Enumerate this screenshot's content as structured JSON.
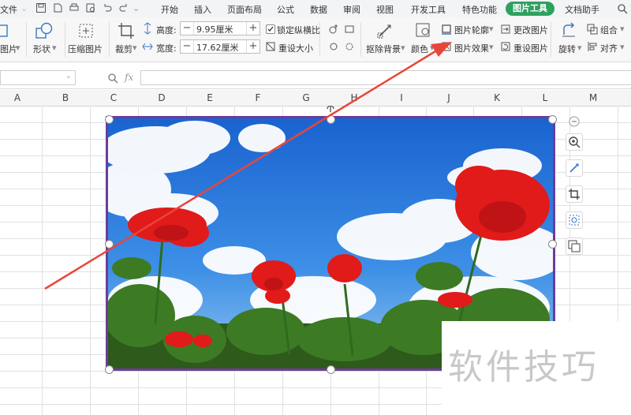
{
  "menubar": {
    "file": "文件",
    "tabs": [
      "开始",
      "插入",
      "页面布局",
      "公式",
      "数据",
      "审阅",
      "视图",
      "开发工具",
      "特色功能",
      "图片工具",
      "文档助手"
    ],
    "active_tab": "图片工具",
    "active_color": "#2ea15f"
  },
  "ribbon": {
    "picture_label": "图片",
    "shape_label": "形状",
    "compress_label": "压缩图片",
    "crop_label": "裁剪",
    "height_label": "高度:",
    "height_value": "9.95厘米",
    "width_label": "宽度:",
    "width_value": "17.62厘米",
    "lock_ratio_label": "锁定纵横比",
    "reset_size_label": "重设大小",
    "remove_bg_label": "抠除背景",
    "color_label": "颜色",
    "outline_label": "图片轮廓",
    "effects_label": "图片效果",
    "change_picture_label": "更改图片",
    "reset_picture_label": "重设图片",
    "rotate_label": "旋转",
    "group_label": "组合",
    "align_label": "对齐"
  },
  "formulabar": {
    "fx_label": "fx"
  },
  "columns": [
    "A",
    "B",
    "C",
    "D",
    "E",
    "F",
    "G",
    "H",
    "I",
    "J",
    "K",
    "L",
    "M"
  ],
  "picture": {
    "border_color": "#6a3d9a"
  },
  "arrow": {
    "color": "#e8463a"
  },
  "watermark": {
    "text": "软件技巧"
  },
  "side_tools": [
    "zoom-in-icon",
    "remove-bg-icon",
    "crop-icon",
    "effects-icon",
    "change-picture-icon"
  ]
}
